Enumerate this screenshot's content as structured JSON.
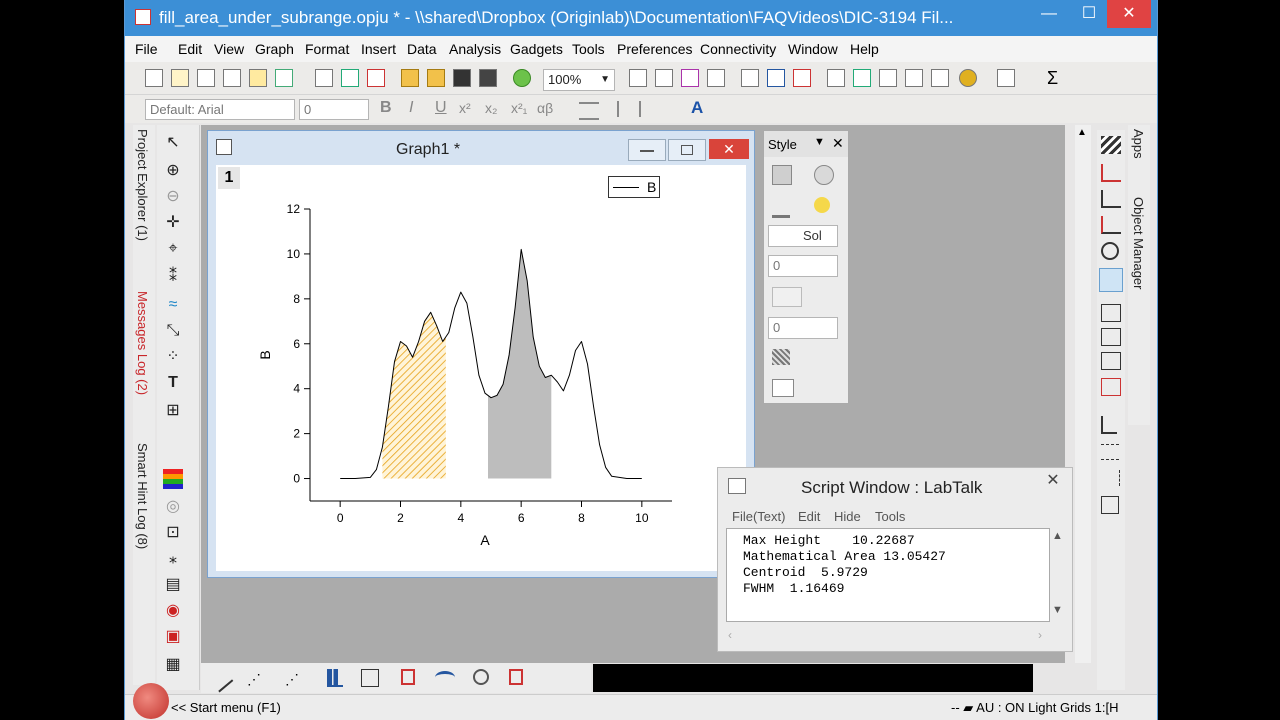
{
  "app": {
    "title": "fill_area_under_subrange.opju * - \\\\shared\\Dropbox (Originlab)\\Documentation\\FAQVideos\\DIC-3194 Fil...",
    "minimize_glyph": "—",
    "maximize_glyph": "☐",
    "close_glyph": "✕"
  },
  "menu": [
    "File",
    "Edit",
    "View",
    "Graph",
    "Format",
    "Insert",
    "Data",
    "Analysis",
    "Gadgets",
    "Tools",
    "Preferences",
    "Connectivity",
    "Window",
    "Help"
  ],
  "toolbar": {
    "zoom_value": "100%",
    "font_value": "Default: Arial",
    "font_size_value": "0",
    "bold": "B",
    "italic": "I",
    "underline": "U",
    "superscript": "x²",
    "subscript": "x₂",
    "supersub": "x²₁",
    "greek": "αβ",
    "text_color": "A",
    "sigma": "Σ"
  },
  "left_panel": {
    "project_explorer": "Project Explorer (1)",
    "messages_log": "Messages Log (2)",
    "smart_hint": "Smart Hint Log (8)"
  },
  "graph_window": {
    "title": "Graph1 *",
    "layer_index": "1",
    "legend_label": "B"
  },
  "chart_data": {
    "type": "area",
    "xlabel": "A",
    "ylabel": "B",
    "xlim": [
      -1,
      11
    ],
    "ylim": [
      -1,
      12
    ],
    "x_ticks": [
      0,
      2,
      4,
      6,
      8,
      10
    ],
    "y_ticks": [
      0,
      2,
      4,
      6,
      8,
      10,
      12
    ],
    "series": [
      {
        "name": "B",
        "x": [
          0,
          0.5,
          1,
          1.2,
          1.4,
          1.6,
          1.8,
          2.0,
          2.2,
          2.4,
          2.6,
          2.8,
          3.0,
          3.2,
          3.4,
          3.6,
          3.8,
          4.0,
          4.2,
          4.4,
          4.6,
          4.8,
          5.0,
          5.2,
          5.4,
          5.6,
          5.8,
          6.0,
          6.2,
          6.4,
          6.6,
          6.8,
          7.0,
          7.2,
          7.4,
          7.6,
          7.8,
          8.0,
          8.2,
          8.4,
          8.6,
          8.8,
          9.0,
          9.5,
          10
        ],
        "y": [
          0,
          0,
          0.05,
          0.4,
          1.4,
          3.2,
          5.2,
          6.1,
          5.9,
          5.4,
          6.1,
          7.0,
          7.4,
          6.8,
          6.1,
          6.5,
          7.6,
          8.3,
          7.8,
          6.3,
          4.6,
          3.8,
          3.6,
          3.7,
          4.2,
          5.5,
          7.6,
          10.2,
          8.8,
          6.3,
          5.0,
          4.5,
          4.6,
          4.3,
          3.9,
          4.6,
          5.7,
          6.1,
          5.1,
          3.2,
          1.5,
          0.5,
          0.1,
          0,
          0
        ]
      }
    ],
    "fill_ranges": [
      {
        "from": 1.4,
        "to": 3.5,
        "pattern": "hatched",
        "color": "#e6a117"
      },
      {
        "from": 4.9,
        "to": 7.0,
        "pattern": "solid",
        "color": "#bdbdbd"
      }
    ]
  },
  "style_panel": {
    "title": "Style",
    "line_style": "Sol",
    "value1": "0",
    "value2": "0"
  },
  "script_window": {
    "title": "Script Window : LabTalk",
    "menu": [
      "File(Text)",
      "Edit",
      "Hide",
      "Tools"
    ],
    "lines": [
      "Max Height    10.22687",
      "Mathematical Area 13.05427",
      "Centroid  5.9729",
      "FWHM  1.16469"
    ]
  },
  "right_panel": {
    "apps": "Apps",
    "object_manager": "Object Manager"
  },
  "status": {
    "start_menu": "<< Start menu (F1)",
    "right_text": "-- ▰ AU : ON Light Grids 1:[H"
  }
}
